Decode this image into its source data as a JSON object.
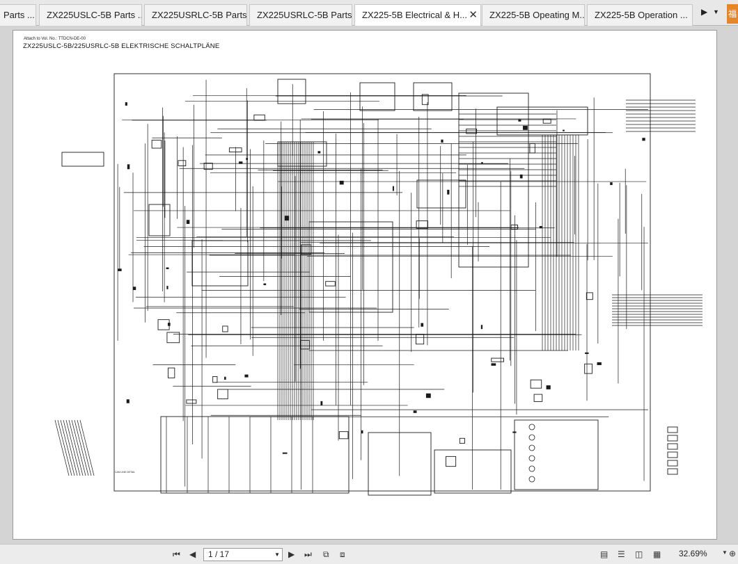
{
  "tabs": [
    {
      "label": "Parts ...",
      "active": false
    },
    {
      "label": "ZX225USLC-5B Parts ...",
      "active": false
    },
    {
      "label": "ZX225USRLC-5B Parts...",
      "active": false
    },
    {
      "label": "ZX225USRLC-5B Parts...",
      "active": false
    },
    {
      "label": "ZX225-5B Electrical & H...",
      "active": true
    },
    {
      "label": "ZX225-5B Opeating M...",
      "active": false
    },
    {
      "label": "ZX225-5B Operation ...",
      "active": false
    }
  ],
  "tab_controls": {
    "next": "▶",
    "list": "▼",
    "corner": "福"
  },
  "document": {
    "attach_note": "Attach to Vol. No.: TTDCN-DE-00",
    "title": "ZX225USLC-5B/225USRLC-5B ELEKTRISCHE SCHALTPLÄNE",
    "bus_label": "CAN LINE DETAIL"
  },
  "statusbar": {
    "page_value": "1 / 17",
    "zoom": "32.69%",
    "icons": [
      "first-page-icon",
      "prev-page-icon",
      "next-page-icon",
      "last-page-icon",
      "rotate-icon",
      "split-icon",
      "single-page-icon",
      "continuous-page-icon",
      "facing-page-icon",
      "continuous-facing-icon",
      "zoom-icon"
    ]
  },
  "colors": {
    "accent": "#e6862a",
    "wire": "#1a1a1a",
    "page": "#ffffff",
    "background": "#d4d4d4"
  }
}
